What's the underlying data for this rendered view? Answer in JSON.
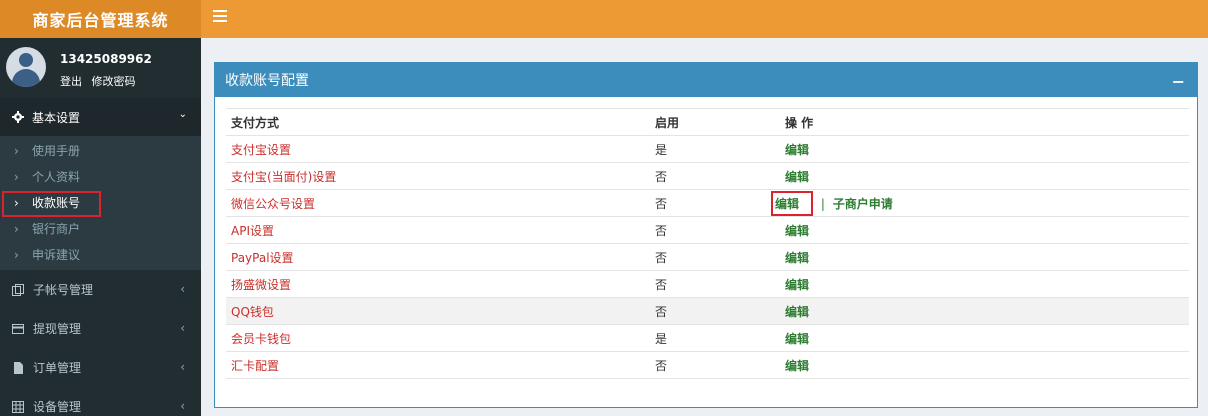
{
  "brand": {
    "title": "商家后台管理系统"
  },
  "user": {
    "name": "13425089962",
    "logout": "登出",
    "change_password": "修改密码"
  },
  "sidebar": {
    "section": {
      "label": "基本设置",
      "chevron": "⌄"
    },
    "subitems": [
      {
        "label": "使用手册"
      },
      {
        "label": "个人资料"
      },
      {
        "label": "收款账号"
      },
      {
        "label": "银行商户"
      },
      {
        "label": "申诉建议"
      }
    ],
    "menu": [
      {
        "label": "子帐号管理"
      },
      {
        "label": "提现管理"
      },
      {
        "label": "订单管理"
      },
      {
        "label": "设备管理"
      }
    ]
  },
  "panel": {
    "title": "收款账号配置",
    "collapse": "−",
    "headers": [
      "支付方式",
      "启用",
      "操 作"
    ],
    "rows": [
      {
        "name": "支付宝设置",
        "enabled": "是",
        "edit": "编辑"
      },
      {
        "name": "支付宝(当面付)设置",
        "enabled": "否",
        "edit": "编辑"
      },
      {
        "name": "微信公众号设置",
        "enabled": "否",
        "edit": "编辑",
        "extra": "子商户申请",
        "sep": "|"
      },
      {
        "name": "API设置",
        "enabled": "否",
        "edit": "编辑"
      },
      {
        "name": "PayPal设置",
        "enabled": "否",
        "edit": "编辑"
      },
      {
        "name": "扬盛微设置",
        "enabled": "否",
        "edit": "编辑"
      },
      {
        "name": "QQ钱包",
        "enabled": "否",
        "edit": "编辑"
      },
      {
        "name": "会员卡钱包",
        "enabled": "是",
        "edit": "编辑"
      },
      {
        "name": "汇卡配置",
        "enabled": "否",
        "edit": "编辑"
      }
    ]
  },
  "colors": {
    "brand": "#dd8a26",
    "topbar": "#ee9a34",
    "sidebar": "#222d32",
    "panel_accent": "#3c8dbc",
    "link_red": "#c9302c",
    "edit_green": "#2e7d32",
    "highlight": "#d9232e"
  }
}
